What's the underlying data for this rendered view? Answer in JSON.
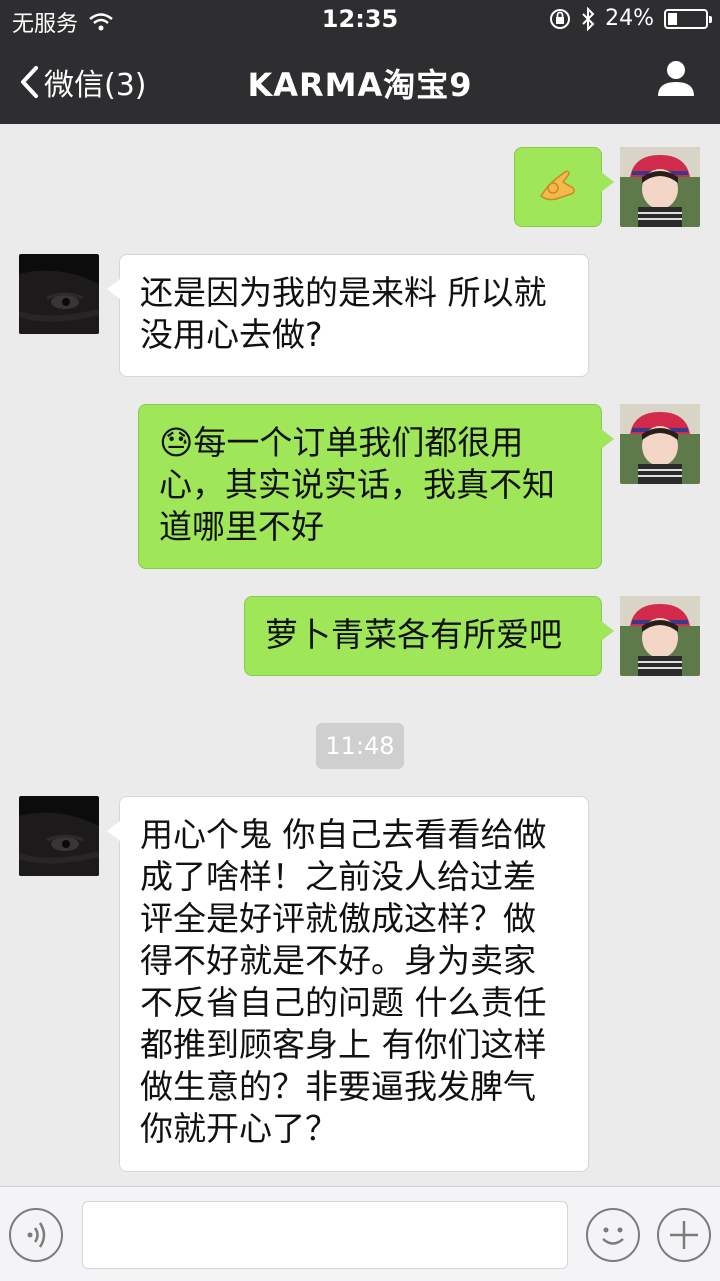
{
  "status_bar": {
    "carrier": "无服务",
    "time": "12:35",
    "battery": "24%",
    "battery_level": 0.24
  },
  "nav": {
    "back_label": "微信(3)",
    "title": "KARMA淘宝9"
  },
  "messages": [
    {
      "from": "me",
      "emoji": "👌"
    },
    {
      "from": "other",
      "text": "还是因为我的是来料 所以就没用心去做?"
    },
    {
      "from": "me",
      "emoji": "😓",
      "text": "每一个订单我们都很用心，其实说实话，我真不知道哪里不好"
    },
    {
      "from": "me",
      "text": "萝卜青菜各有所爱吧"
    },
    {
      "type": "timestamp",
      "text": "11:48"
    },
    {
      "from": "other",
      "text": "用心个鬼 你自己去看看给做成了啥样！之前没人给过差评全是好评就傲成这样？做得不好就是不好。身为卖家不反省自己的问题 什么责任都推到顾客身上 有你们这样做生意的？非要逼我发脾气你就开心了？"
    }
  ],
  "colors": {
    "nav_bg": "#2e2e30",
    "bubble_out": "#9fe658",
    "bubble_in": "#ffffff",
    "chat_bg": "#ebebeb"
  },
  "icons": [
    "wifi-icon",
    "lock-rotation-icon",
    "bluetooth-icon",
    "battery-icon",
    "back-chevron-icon",
    "profile-icon",
    "voice-icon",
    "emoji-icon",
    "plus-icon"
  ]
}
